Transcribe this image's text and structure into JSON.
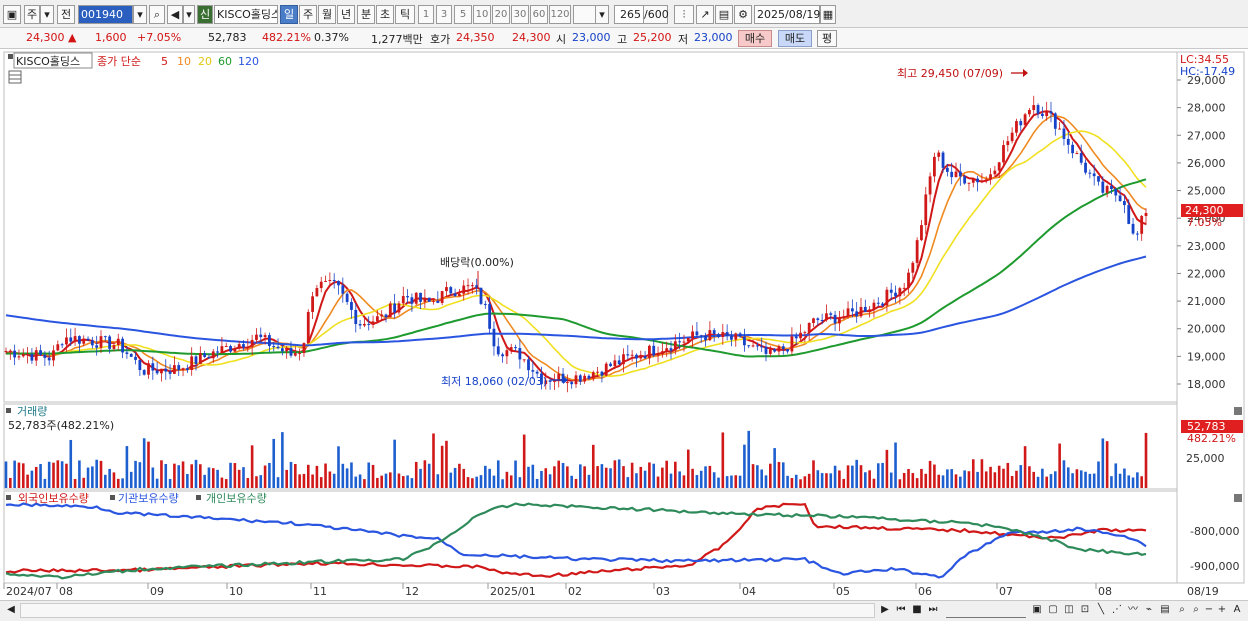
{
  "toolbar": {
    "period_prefix": "주",
    "prev_label": "전",
    "code": "001940",
    "type_badge": "신",
    "stock_name": "KISCO홀딩스",
    "periods": [
      "일",
      "주",
      "월",
      "년",
      "분",
      "초",
      "틱"
    ],
    "selected_period": "일",
    "intervals": [
      "1",
      "3",
      "5",
      "10",
      "20",
      "30",
      "60",
      "120"
    ],
    "count": "265",
    "count_max": "/600",
    "date": "2025/08/19"
  },
  "quote": {
    "price": "24,300",
    "arrow": "▲",
    "change": "1,600",
    "change_pct": "+7.05%",
    "volume": "52,783",
    "volume_pct": "482.21%",
    "turnover": "0.37%",
    "amount": "1,277백만",
    "bid_label": "호가",
    "bid1": "24,350",
    "bid2": "24,300",
    "open_label": "시",
    "open": "23,000",
    "high_label": "고",
    "high": "25,200",
    "low_label": "저",
    "low": "23,000",
    "buy_label": "매수",
    "sell_label": "매도",
    "flat_label": "평"
  },
  "price_panel": {
    "legend_name": "KISCO홀딩스",
    "legend_type": "종가 단순",
    "ma_periods": [
      "5",
      "10",
      "20",
      "60",
      "120"
    ],
    "ma_colors": [
      "#d01818",
      "#f08a20",
      "#f0e020",
      "#1e9a2e",
      "#2a55e0"
    ],
    "lc_label": "LC:34.55",
    "hc_label": "HC:-17.49",
    "y_ticks": [
      "29,000",
      "28,000",
      "27,000",
      "26,000",
      "25,000",
      "24,000",
      "23,000",
      "22,000",
      "21,000",
      "20,000",
      "19,000",
      "18,000"
    ],
    "current_price_tag": "24,300",
    "current_pct_tag": "7.05%",
    "high_annotation": "최고 29,450 (07/09)",
    "low_annotation": "최저 18,060 (02/03)",
    "dividend_annotation": "배당락(0.00%)"
  },
  "volume_panel": {
    "title": "거래량",
    "summary": "52,783주(482.21%)",
    "tick": "25,000",
    "current_tag": "52,783",
    "current_pct_tag": "482.21%"
  },
  "holdings_panel": {
    "legend": [
      "외국인보유수량",
      "기관보유수량",
      "개인보유수량"
    ],
    "colors": [
      "#d01818",
      "#2a55e0",
      "#2e8a5a"
    ],
    "ticks": [
      "-800,000",
      "-900,000"
    ]
  },
  "x_axis": {
    "labels": [
      "2024/07",
      "08",
      "09",
      "10",
      "11",
      "12",
      "2025/01",
      "02",
      "03",
      "04",
      "05",
      "06",
      "07",
      "08"
    ],
    "right_label": "08/19"
  }
}
